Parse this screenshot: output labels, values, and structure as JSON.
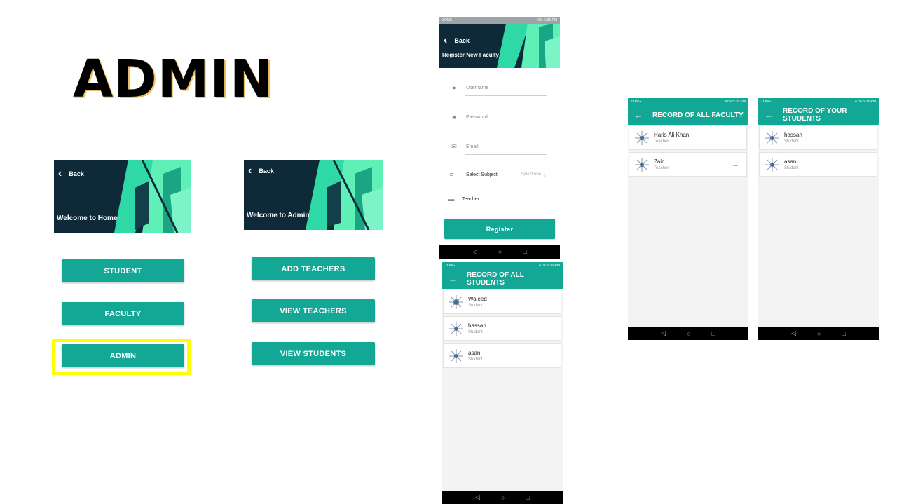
{
  "slide": {
    "title": "ADMIN"
  },
  "home_screen": {
    "back_label": "Back",
    "welcome": "Welcome to Home",
    "buttons": [
      "STUDENT",
      "FACULTY",
      "ADMIN"
    ]
  },
  "admin_screen": {
    "back_label": "Back",
    "welcome": "Welcome to Admin",
    "buttons": [
      "ADD TEACHERS",
      "VIEW TEACHERS",
      "VIEW STUDENTS"
    ]
  },
  "register_screen": {
    "status_left": "ZONG",
    "status_right": "41% 5:36 PM",
    "back_label": "Back",
    "title": "Register New Faculty",
    "fields": {
      "username_placeholder": "Username",
      "password_placeholder": "Password",
      "email_placeholder": "Email",
      "subject_label": "Select Subject",
      "subject_value": "Select one",
      "role_value": "Teacher"
    },
    "register_button": "Register"
  },
  "students_screen": {
    "status_left": "ZONG",
    "status_right": "41% 5:36 PM",
    "title": "RECORD OF ALL STUDENTS",
    "records": [
      {
        "name": "Waleed",
        "role": "Student"
      },
      {
        "name": "hassan",
        "role": "Student"
      },
      {
        "name": "asan",
        "role": "Student"
      }
    ]
  },
  "faculty_screen": {
    "status_left": "ZONG",
    "status_right": "41% 5:36 PM",
    "title": "RECORD OF ALL FACULTY",
    "records": [
      {
        "name": "Haris Ali Khan",
        "role": "Teacher"
      },
      {
        "name": "Zain",
        "role": "Teacher"
      }
    ]
  },
  "your_students_screen": {
    "status_left": "ZONG",
    "status_right": "41% 5:36 PM",
    "title": "RECORD OF YOUR STUDENTS",
    "records": [
      {
        "name": "hassan",
        "role": "Student"
      },
      {
        "name": "asan",
        "role": "Student"
      }
    ]
  },
  "colors": {
    "accent": "#13a896",
    "highlight": "#ffff00",
    "banner_bg": "#0e2a38"
  },
  "icons": {
    "back": "chevron-left-icon",
    "arrow": "arrow-left-icon",
    "go": "arrow-right-icon"
  }
}
